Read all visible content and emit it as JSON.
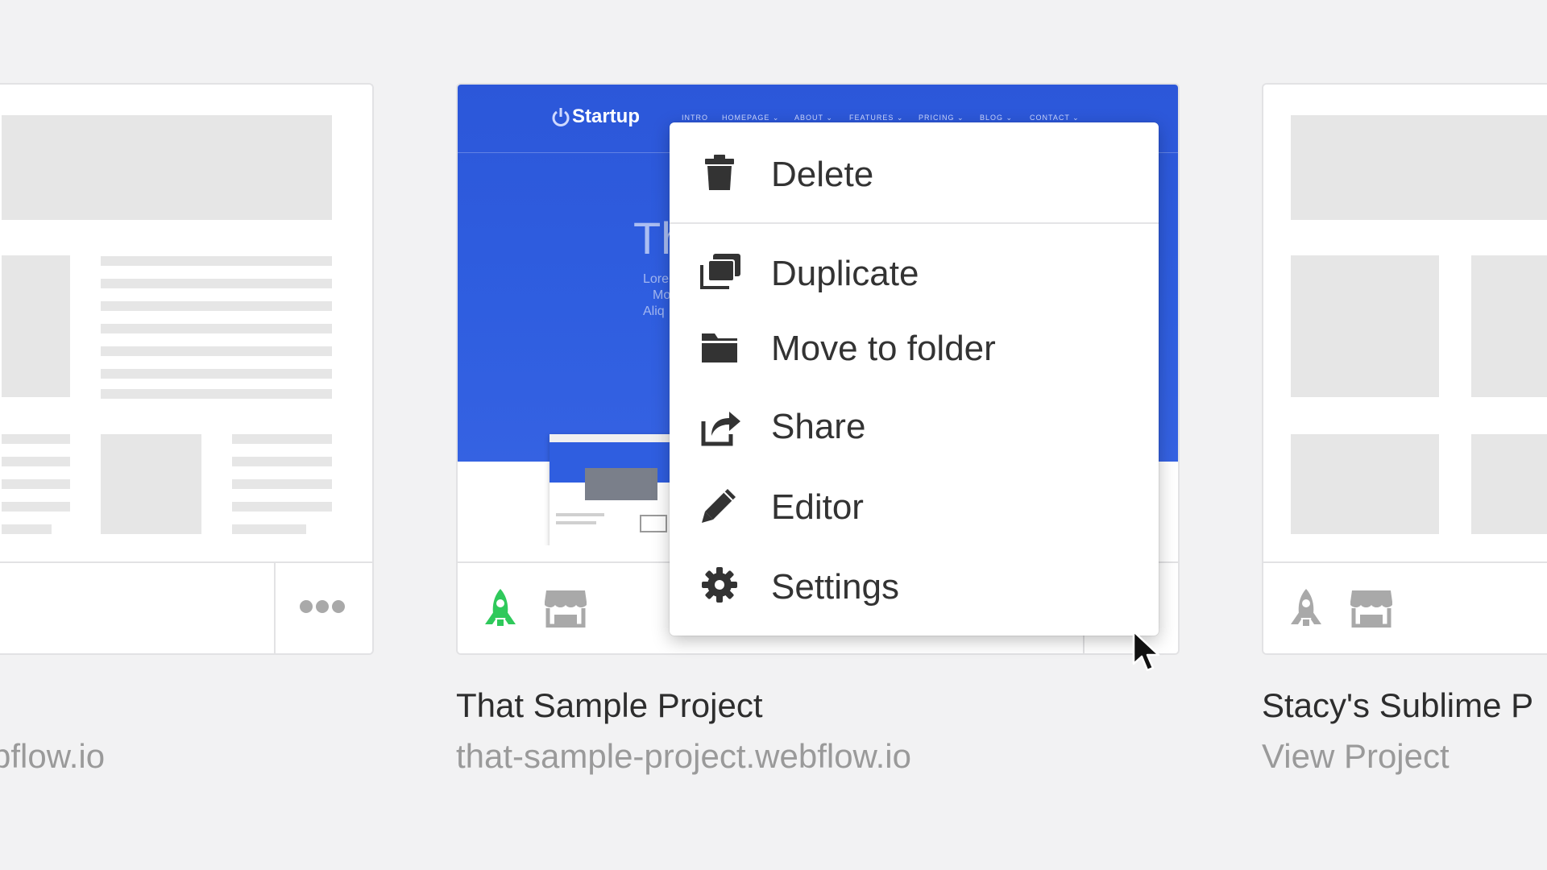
{
  "colors": {
    "background": "#f2f2f3",
    "card_border": "#e2e2e4",
    "wireframe": "#e6e6e6",
    "thumbnail_blue": "#2f5ee0",
    "published_green": "#2fc95b",
    "icon_gray": "#a9a9a9",
    "menu_text": "#333333"
  },
  "left_card": {
    "subtitle": "bflow.io",
    "more_icon": "ellipsis-icon"
  },
  "middle_card": {
    "title": "That Sample Project",
    "subtitle": "that-sample-project.webflow.io",
    "thumbnail": {
      "brand": "Startup",
      "nav": [
        "INTRO",
        "HOMEPAGE ⌄",
        "ABOUT ⌄",
        "FEATURES ⌄",
        "PRICING ⌄",
        "BLOG ⌄",
        "CONTACT ⌄"
      ],
      "hero_fragment": "Th",
      "hero_lines": [
        "Lore",
        "Mo",
        "Aliq"
      ]
    },
    "footer_icons": [
      "rocket-icon",
      "storefront-icon"
    ]
  },
  "right_card": {
    "title": "Stacy's Sublime P",
    "subtitle": "View Project",
    "footer_icons": [
      "rocket-icon",
      "storefront-icon"
    ]
  },
  "context_menu": {
    "items": [
      {
        "label": "Delete",
        "icon": "trash-icon"
      },
      {
        "label": "Duplicate",
        "icon": "duplicate-icon"
      },
      {
        "label": "Move to folder",
        "icon": "folder-icon"
      },
      {
        "label": "Share",
        "icon": "share-icon"
      },
      {
        "label": "Editor",
        "icon": "pencil-icon"
      },
      {
        "label": "Settings",
        "icon": "gear-icon"
      }
    ]
  }
}
